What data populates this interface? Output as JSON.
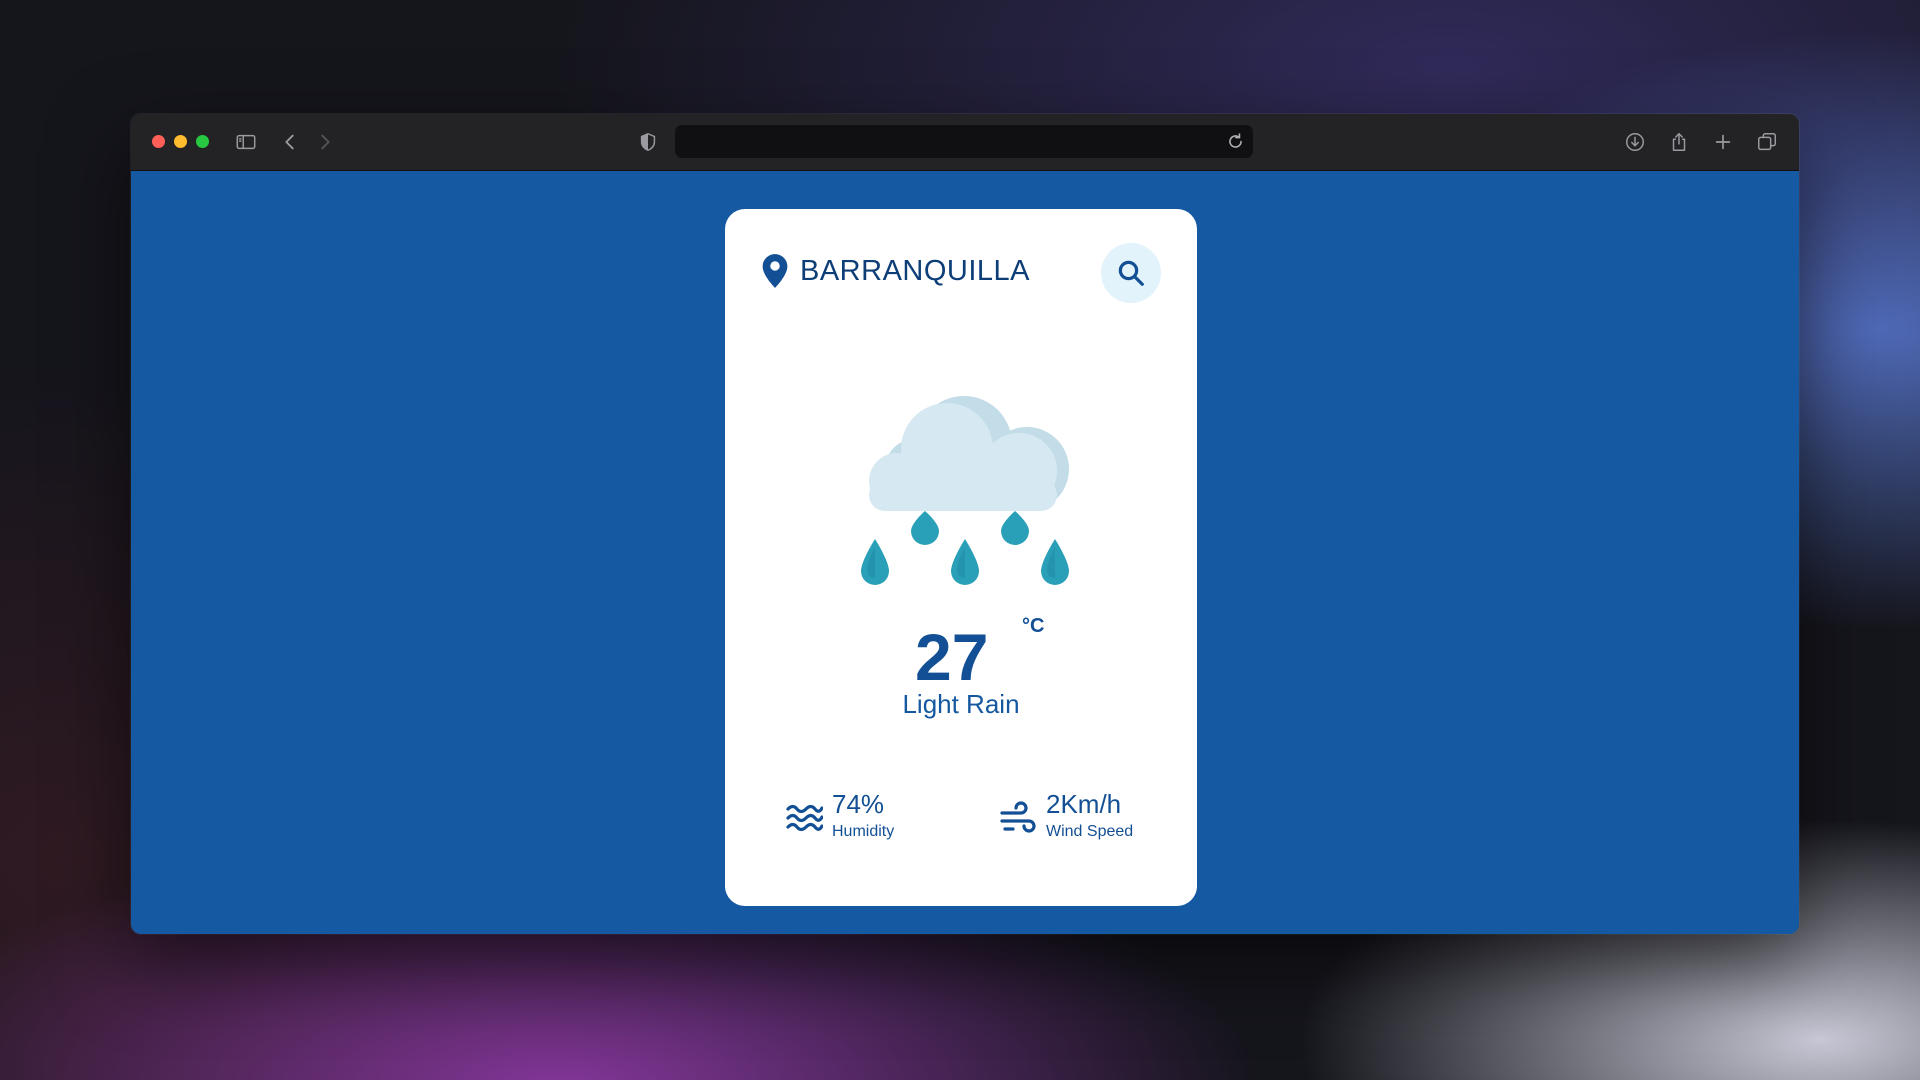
{
  "browser": {
    "address_text": "",
    "icons": [
      "sidebar-icon",
      "back-icon",
      "forward-icon",
      "shield-icon",
      "reload-icon",
      "download-icon",
      "share-icon",
      "new-tab-icon",
      "tab-overview-icon"
    ]
  },
  "colors": {
    "page_background": "#1459a2",
    "card_background": "#ffffff",
    "accent": "#134f95",
    "search_button_bg": "#e3f3fb",
    "cloud": "#d6e9f2",
    "rain_drop": "#2a9fb8"
  },
  "weather": {
    "city": "BARRANQUILLA",
    "icon": "light-rain-cloud-icon",
    "temperature": "27",
    "unit": "°C",
    "condition": "Light Rain",
    "humidity": {
      "value": "74%",
      "label": "Humidity",
      "icon": "humidity-waves-icon"
    },
    "wind": {
      "value": "2Km/h",
      "label": "Wind Speed",
      "icon": "wind-icon"
    }
  }
}
